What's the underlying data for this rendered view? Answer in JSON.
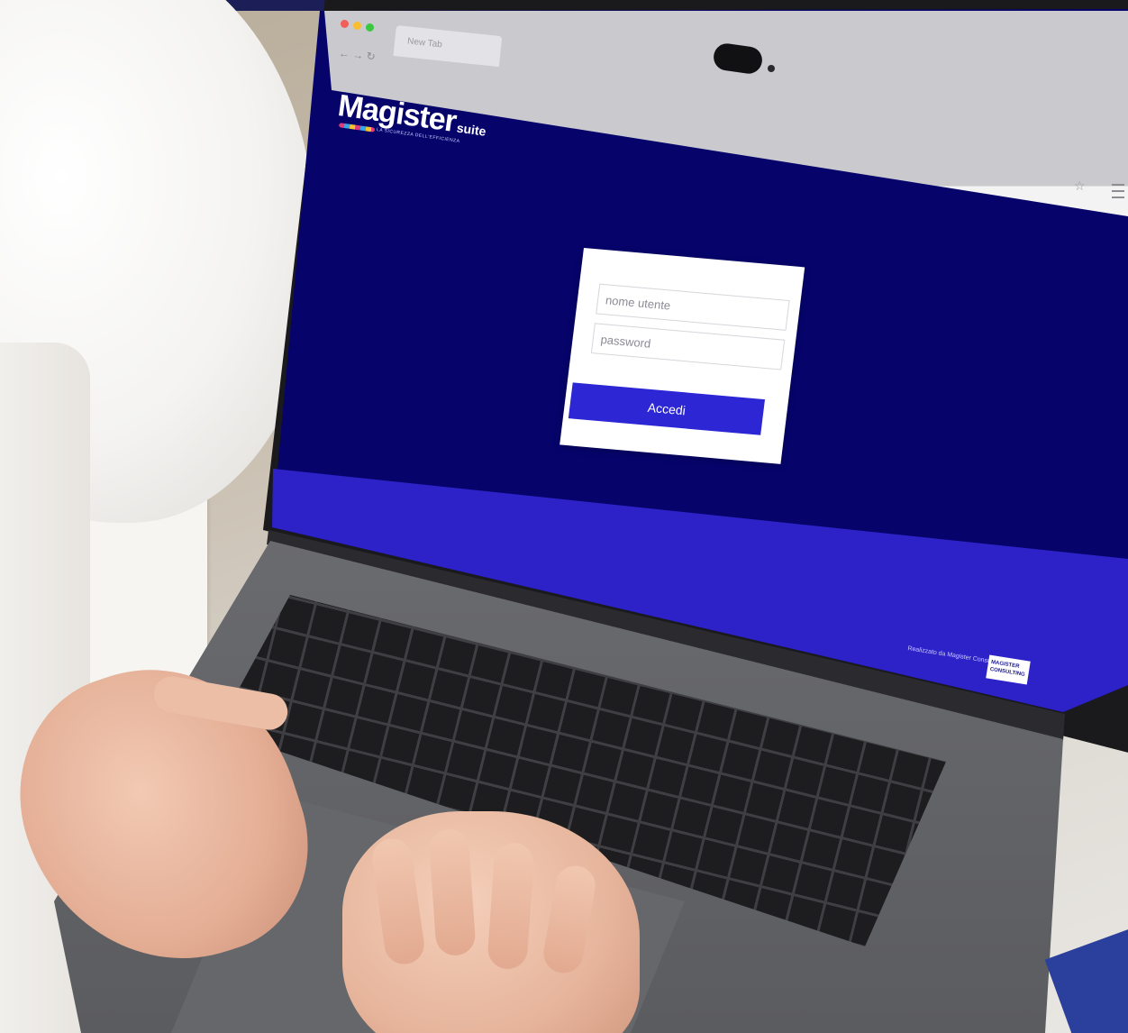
{
  "banner": {
    "color": "#1c1e58"
  },
  "browser": {
    "tab_label": "New Tab",
    "colors": {
      "close": "#f25f58",
      "minimize": "#fbbe2e",
      "maximize": "#39c840"
    }
  },
  "app": {
    "logo_main": "Magister",
    "logo_suffix": "suite",
    "logo_tagline": "LA SICUREZZA DELL'EFFICIENZA",
    "background_color": "#06046b",
    "accent_color": "#2c26d4"
  },
  "login": {
    "username_placeholder": "nome utente",
    "password_placeholder": "password",
    "submit_label": "Accedi"
  },
  "footer": {
    "powered_text": "Realizzato da Magister Consulting",
    "badge_text": "MAGISTER CONSULTING"
  },
  "icons": {
    "back": "back-arrow-icon",
    "forward": "forward-arrow-icon",
    "reload": "reload-icon",
    "bookmark": "star-icon",
    "menu": "menu-icon"
  }
}
